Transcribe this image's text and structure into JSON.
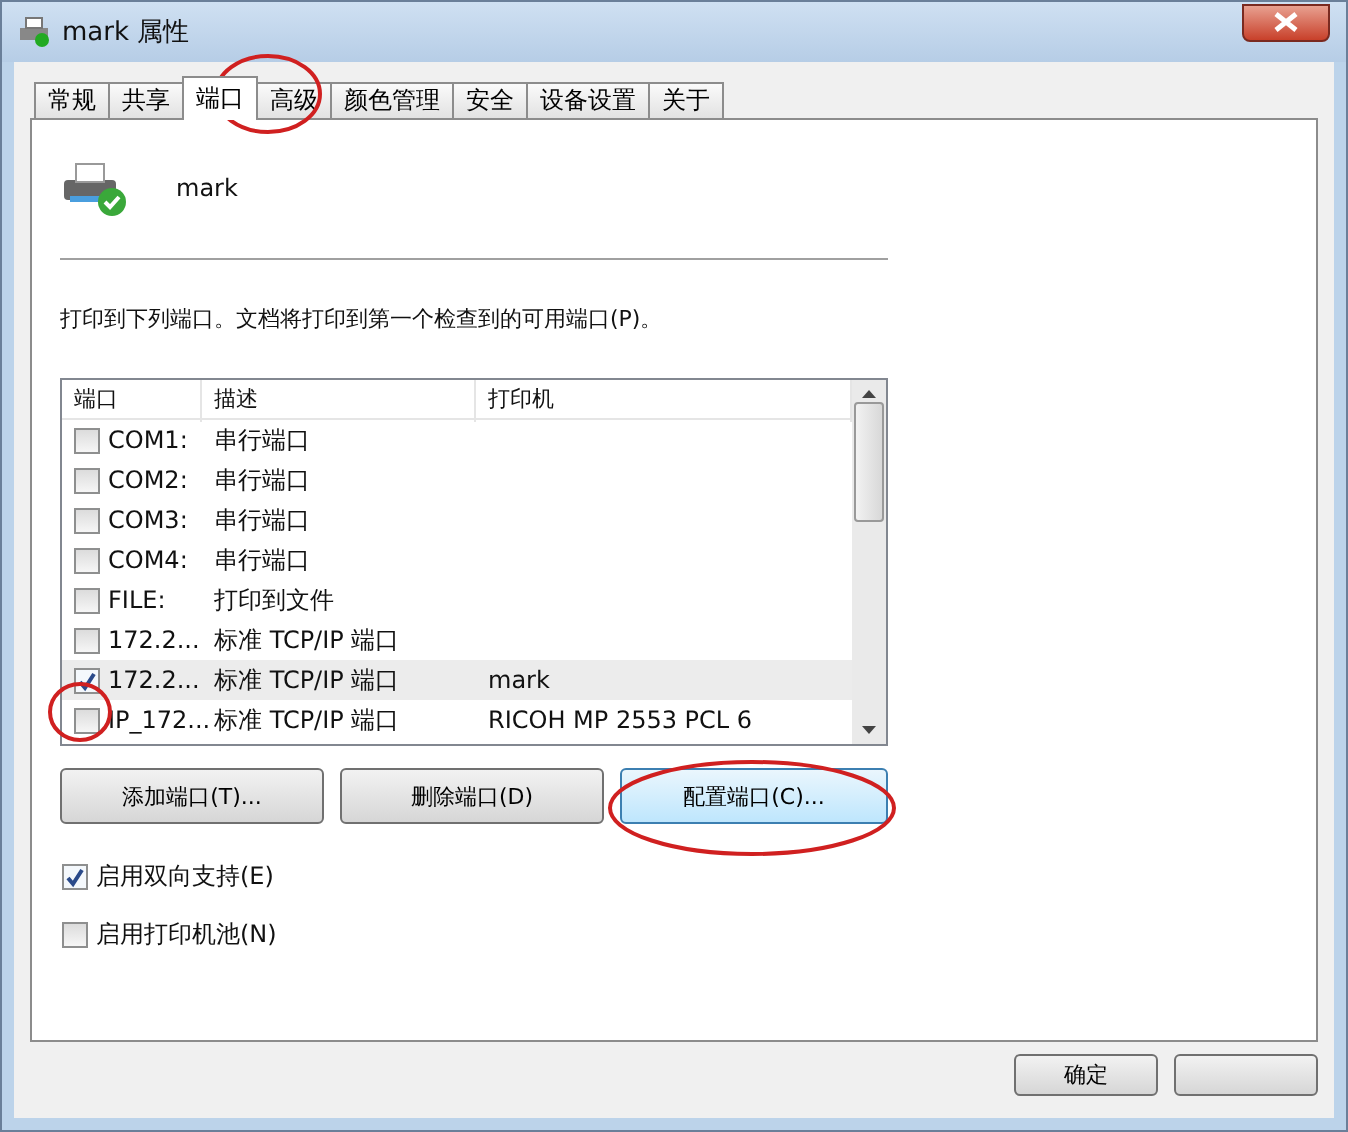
{
  "window": {
    "title": "mark 属性"
  },
  "tabs": [
    {
      "label": "常规",
      "selected": false
    },
    {
      "label": "共享",
      "selected": false
    },
    {
      "label": "端口",
      "selected": true
    },
    {
      "label": "高级",
      "selected": false
    },
    {
      "label": "颜色管理",
      "selected": false
    },
    {
      "label": "安全",
      "selected": false
    },
    {
      "label": "设备设置",
      "selected": false
    },
    {
      "label": "关于",
      "selected": false
    }
  ],
  "printer_name": "mark",
  "instruction": "打印到下列端口。文档将打印到第一个检查到的可用端口(P)。",
  "port_list": {
    "columns": [
      "端口",
      "描述",
      "打印机"
    ],
    "rows": [
      {
        "port": "COM1:",
        "description": "串行端口",
        "printer": "",
        "checked": false,
        "selected": false
      },
      {
        "port": "COM2:",
        "description": "串行端口",
        "printer": "",
        "checked": false,
        "selected": false
      },
      {
        "port": "COM3:",
        "description": "串行端口",
        "printer": "",
        "checked": false,
        "selected": false
      },
      {
        "port": "COM4:",
        "description": "串行端口",
        "printer": "",
        "checked": false,
        "selected": false
      },
      {
        "port": "FILE:",
        "description": "打印到文件",
        "printer": "",
        "checked": false,
        "selected": false
      },
      {
        "port": "172.2...",
        "description": "标准 TCP/IP 端口",
        "printer": "",
        "checked": false,
        "selected": false
      },
      {
        "port": "172.2...",
        "description": "标准 TCP/IP 端口",
        "printer": "mark",
        "checked": true,
        "selected": true
      },
      {
        "port": "IP_172...",
        "description": "标准 TCP/IP 端口",
        "printer": "RICOH MP 2553 PCL 6",
        "checked": false,
        "selected": false
      }
    ]
  },
  "port_buttons": [
    {
      "label": "添加端口(T)...",
      "focused": false
    },
    {
      "label": "删除端口(D)",
      "focused": false
    },
    {
      "label": "配置端口(C)...",
      "focused": true
    }
  ],
  "options": [
    {
      "label": "启用双向支持(E)",
      "checked": true
    },
    {
      "label": "启用打印机池(N)",
      "checked": false
    }
  ],
  "dialog_buttons": [
    "确定"
  ]
}
